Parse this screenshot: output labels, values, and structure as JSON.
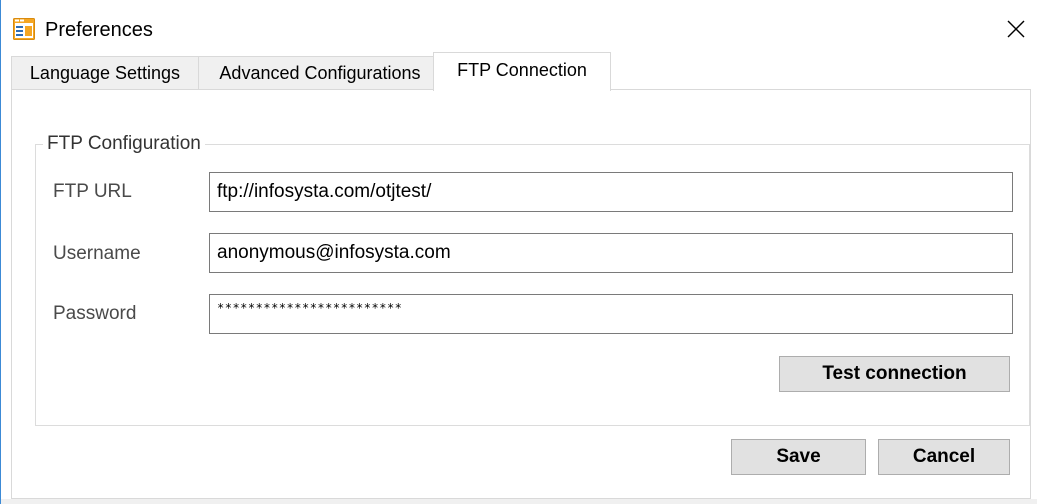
{
  "window": {
    "title": "Preferences",
    "app_icon": "preferences-window-icon",
    "close_icon": "close-icon"
  },
  "tabs": [
    {
      "label": "Language Settings",
      "active": false
    },
    {
      "label": "Advanced Configurations",
      "active": false
    },
    {
      "label": "FTP Connection",
      "active": true
    }
  ],
  "ftp": {
    "group_title": "FTP Configuration",
    "url_label": "FTP URL",
    "url_value": "ftp://infosysta.com/otjtest/",
    "username_label": "Username",
    "username_value": "anonymous@infosysta.com",
    "password_label": "Password",
    "password_value": "************************",
    "test_button": "Test connection"
  },
  "footer": {
    "save_label": "Save",
    "cancel_label": "Cancel"
  },
  "colors": {
    "window_border": "#3c8ad6",
    "button_bg": "#e1e1e1",
    "icon_orange": "#f5a623",
    "icon_blue": "#2f6db5"
  }
}
